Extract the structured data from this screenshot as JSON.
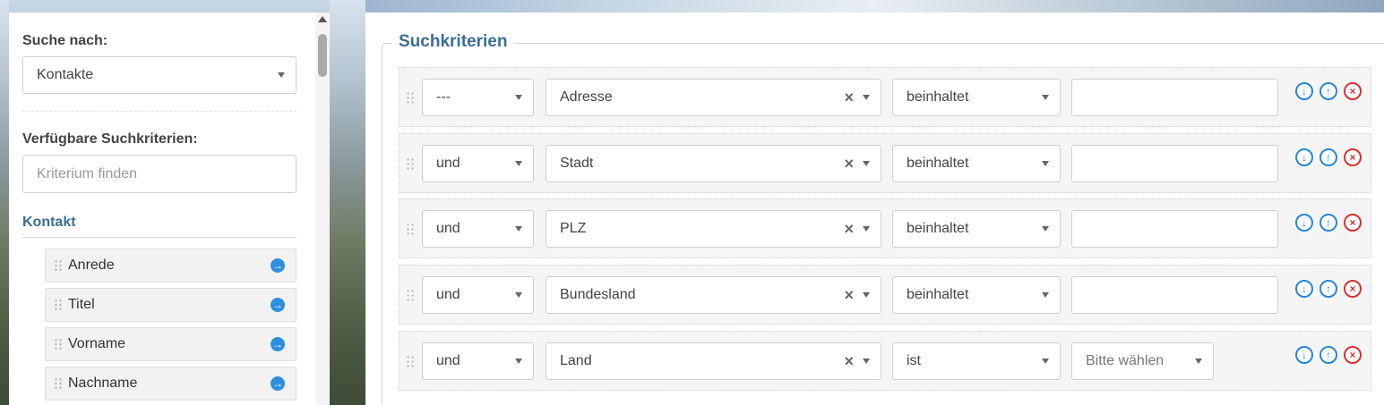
{
  "left": {
    "search_label": "Suche nach:",
    "search_select": "Kontakte",
    "criteria_label": "Verfügbare Suchkriterien:",
    "criteria_search_placeholder": "Kriterium finden",
    "section_title": "Kontakt",
    "fields": [
      "Anrede",
      "Titel",
      "Vorname",
      "Nachname"
    ]
  },
  "right": {
    "legend": "Suchkriterien",
    "rows": [
      {
        "conj": "---",
        "field": "Adresse",
        "op": "beinhaltet",
        "value": ""
      },
      {
        "conj": "und",
        "field": "Stadt",
        "op": "beinhaltet",
        "value": ""
      },
      {
        "conj": "und",
        "field": "PLZ",
        "op": "beinhaltet",
        "value": ""
      },
      {
        "conj": "und",
        "field": "Bundesland",
        "op": "beinhaltet",
        "value": ""
      },
      {
        "conj": "und",
        "field": "Land",
        "op": "ist",
        "value_select": "Bitte wählen"
      }
    ]
  },
  "colors": {
    "accent": "#3a6e96",
    "icon_blue": "#2a86d6",
    "icon_red": "#d63232"
  }
}
